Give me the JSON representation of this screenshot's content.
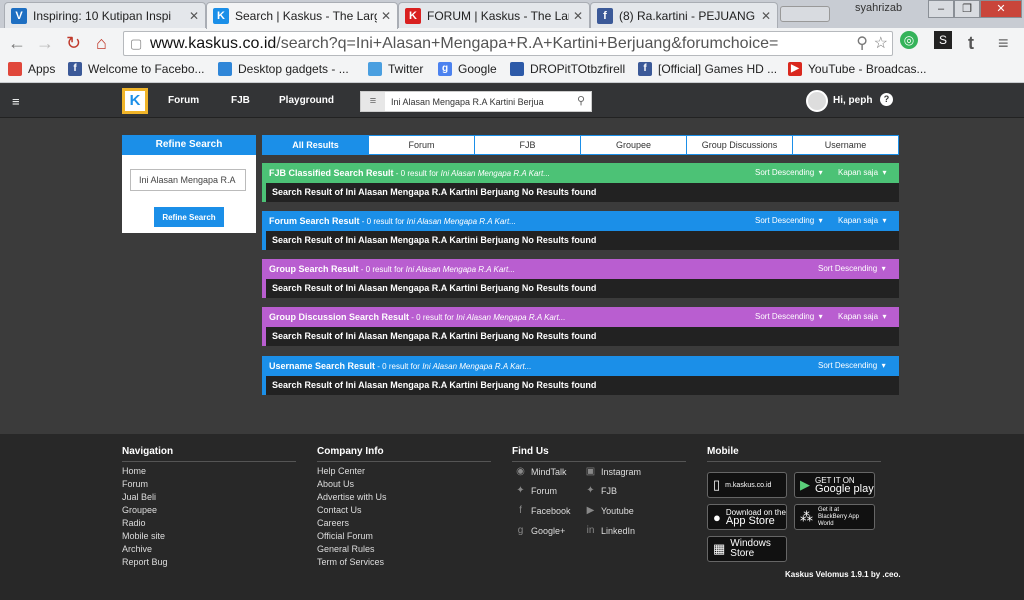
{
  "browser": {
    "tabs": [
      {
        "title": "Inspiring: 10 Kutipan Inspi",
        "favicon": "V",
        "favicon_color": "#1e6fc2"
      },
      {
        "title": "Search | Kaskus - The Larg",
        "favicon": "K",
        "favicon_color": "#1b8fe8"
      },
      {
        "title": "FORUM | Kaskus - The Lar",
        "favicon": "K",
        "favicon_color": "#1b8fe8"
      },
      {
        "title": "(8) Ra.kartini - PEJUANG E",
        "favicon": "f",
        "favicon_color": "#3b5998"
      }
    ],
    "window_user": "syahrizab",
    "url_host": "www.kaskus.co.id",
    "url_path": "/search?q=Ini+Alasan+Mengapa+R.A+Kartini+Berjuang&forumchoice=",
    "bookmarks": [
      {
        "label": "Apps",
        "icon": "apps-grid-icon",
        "color": "#e0473b"
      },
      {
        "label": "Welcome to Facebo...",
        "icon": "facebook-icon",
        "color": "#3b5998"
      },
      {
        "label": "Desktop gadgets - ...",
        "icon": "windows-icon",
        "color": "#2f86d8"
      },
      {
        "label": "Twitter",
        "icon": "twitter-icon",
        "color": "#4a9fe0"
      },
      {
        "label": "Google",
        "icon": "google-icon",
        "color": "#4c82ef"
      },
      {
        "label": "DROPitTOtbzfirell",
        "icon": "dropbox-icon",
        "color": "#2d5aa8"
      },
      {
        "label": "[Official] Games HD ...",
        "icon": "facebook-icon",
        "color": "#3b5998"
      },
      {
        "label": "YouTube - Broadcas...",
        "icon": "youtube-icon",
        "color": "#d9281e"
      }
    ]
  },
  "kaskus": {
    "menu": [
      "Forum",
      "FJB",
      "Playground"
    ],
    "search_value": "Ini Alasan Mengapa R.A Kartini Berjua",
    "greeting": "Hi, peph",
    "refine": {
      "title": "Refine Search",
      "input_value": "Ini Alasan Mengapa R.A",
      "button": "Refine Search"
    },
    "tabs": [
      "All Results",
      "Forum",
      "FJB",
      "Groupee",
      "Group Discussions",
      "Username"
    ],
    "results": [
      {
        "title": "FJB Classified Search Result",
        "count": " - 0 result for ",
        "query": "Ini Alasan Mengapa R.A Kart...",
        "sort": "Sort Descending",
        "filter": "Kapan saja",
        "body": "Search Result of Ini Alasan Mengapa R.A Kartini Berjuang No Results found",
        "color": "#4cc276"
      },
      {
        "title": "Forum Search Result",
        "count": " - 0 result for ",
        "query": "Ini Alasan Mengapa R.A Kart...",
        "sort": "Sort Descending",
        "filter": "Kapan saja",
        "body": "Search Result of Ini Alasan Mengapa R.A Kartini Berjuang No Results found",
        "color": "#1b8fe8"
      },
      {
        "title": "Group Search Result",
        "count": " - 0 result for ",
        "query": "Ini Alasan Mengapa R.A Kart...",
        "sort": "Sort Descending",
        "filter": "",
        "body": "Search Result of Ini Alasan Mengapa R.A Kartini Berjuang No Results found",
        "color": "#b95ed0"
      },
      {
        "title": "Group Discussion Search Result",
        "count": " - 0 result for ",
        "query": "Ini Alasan Mengapa R.A Kart...",
        "sort": "Sort Descending",
        "filter": "Kapan saja",
        "body": "Search Result of Ini Alasan Mengapa R.A Kartini Berjuang No Results found",
        "color": "#b95ed0"
      },
      {
        "title": "Username Search Result",
        "count": " - 0 result for ",
        "query": "Ini Alasan Mengapa R.A Kart...",
        "sort": "Sort Descending",
        "filter": "",
        "body": "Search Result of Ini Alasan Mengapa R.A Kartini Berjuang No Results found",
        "color": "#1b8fe8"
      }
    ]
  },
  "footer": {
    "navigation": {
      "title": "Navigation",
      "links": [
        "Home",
        "Forum",
        "Jual Beli",
        "Groupee",
        "Radio",
        "Mobile site",
        "Archive",
        "Report Bug"
      ]
    },
    "company": {
      "title": "Company Info",
      "links": [
        "Help Center",
        "About Us",
        "Advertise with Us",
        "Contact Us",
        "Careers",
        "Official Forum",
        "General Rules",
        "Term of Services"
      ]
    },
    "findus": {
      "title": "Find Us",
      "links": [
        "MindTalk",
        "Instagram",
        "Forum",
        "FJB",
        "Facebook",
        "Youtube",
        "Google+",
        "LinkedIn"
      ]
    },
    "mobile": {
      "title": "Mobile",
      "site": "m.kaskus.co.id",
      "gp_small": "GET IT ON",
      "gp_big": "Google play",
      "as_small": "Download on the",
      "as_big": "App Store",
      "bb_small": "Get it at",
      "bb_big": "BlackBerry App World",
      "ws_big": "Windows Store"
    },
    "version": "Kaskus Velomus 1.9.1 by .ceo."
  }
}
